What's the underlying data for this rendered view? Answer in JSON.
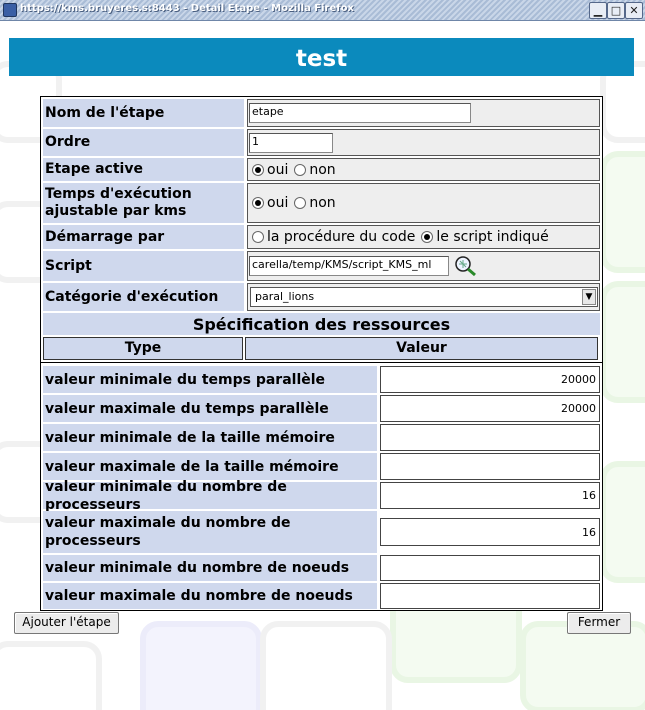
{
  "window": {
    "title": "https://kms.bruyeres.s:8443 - Detail Etape - Mozilla Firefox",
    "buttons": {
      "minimize": "▁",
      "maximize": "□",
      "close": "✕"
    }
  },
  "header": {
    "title": "test"
  },
  "form": {
    "nom_label": "Nom de l'étape",
    "nom_value": "etape",
    "ordre_label": "Ordre",
    "ordre_value": "1",
    "active_label": "Etape active",
    "active_options": {
      "oui": "oui",
      "non": "non"
    },
    "active_selected": "oui",
    "temps_label": "Temps d'exécution ajustable par kms",
    "temps_options": {
      "oui": "oui",
      "non": "non"
    },
    "temps_selected": "oui",
    "demarrage_label": "Démarrage par",
    "demarrage_options": {
      "procedure": "la procédure du code",
      "script": "le script indiqué"
    },
    "demarrage_selected": "script",
    "script_label": "Script",
    "script_value": "carella/temp/KMS/script_KMS_ml",
    "script_icon": "search-icon",
    "categorie_label": "Catégorie d'exécution",
    "categorie_value": "paral_lions"
  },
  "resources": {
    "section_title": "Spécification des ressources",
    "col_type": "Type",
    "col_valeur": "Valeur",
    "rows": [
      {
        "label": "valeur minimale du temps parallèle",
        "value": "20000"
      },
      {
        "label": "valeur maximale du temps parallèle",
        "value": "20000"
      },
      {
        "label": "valeur minimale de la taille mémoire",
        "value": ""
      },
      {
        "label": "valeur maximale de la taille mémoire",
        "value": ""
      },
      {
        "label": "valeur minimale du nombre de processeurs",
        "value": "16"
      },
      {
        "label": "valeur maximale du nombre de processeurs",
        "value": "16"
      },
      {
        "label": "valeur minimale du nombre de noeuds",
        "value": ""
      },
      {
        "label": "valeur maximale du nombre de noeuds",
        "value": ""
      }
    ]
  },
  "actions": {
    "add_label": "Ajouter l'étape",
    "close_label": "Fermer"
  },
  "colors": {
    "header": "#0b8abd",
    "label_bg": "#cfd8ed"
  }
}
